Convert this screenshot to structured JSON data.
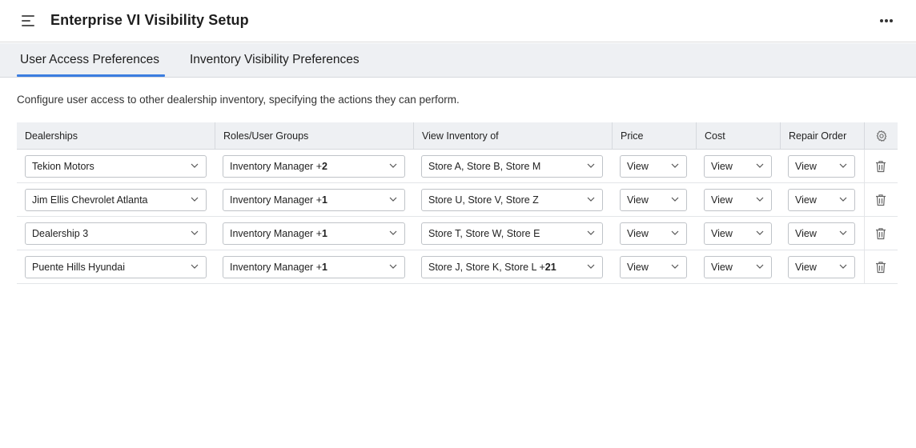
{
  "header": {
    "title": "Enterprise VI Visibility Setup",
    "menu_icon": "hamburger-menu-icon",
    "more_icon": "more-horizontal-icon"
  },
  "tabs": [
    {
      "label": "User Access Preferences",
      "active": true
    },
    {
      "label": "Inventory Visibility Preferences",
      "active": false
    }
  ],
  "colors": {
    "accent": "#3b7de0",
    "header_bg": "#eef0f3"
  },
  "description": "Configure user access to other dealership inventory, specifying the actions they can perform.",
  "table": {
    "columns": [
      "Dealerships",
      "Roles/User Groups",
      "View Inventory of",
      "Price",
      "Cost",
      "Repair Order"
    ],
    "settings_icon": "gear-icon",
    "delete_icon": "trash-icon",
    "rows": [
      {
        "dealership": "Tekion Motors",
        "roles": "Inventory Manager +",
        "roles_count": "2",
        "stores": "Store A, Store B, Store M",
        "stores_count": "",
        "price": "View",
        "cost": "View",
        "repair_order": "View"
      },
      {
        "dealership": "Jim Ellis Chevrolet Atlanta",
        "roles": "Inventory Manager +",
        "roles_count": "1",
        "stores": "Store U, Store V, Store Z",
        "stores_count": "",
        "price": "View",
        "cost": "View",
        "repair_order": "View"
      },
      {
        "dealership": "Dealership 3",
        "roles": "Inventory Manager +",
        "roles_count": "1",
        "stores": "Store T, Store W, Store E",
        "stores_count": "",
        "price": "View",
        "cost": "View",
        "repair_order": "View"
      },
      {
        "dealership": "Puente Hills Hyundai",
        "roles": "Inventory Manager +",
        "roles_count": "1",
        "stores": "Store J, Store K, Store L +",
        "stores_count": "21",
        "price": "View",
        "cost": "View",
        "repair_order": "View"
      }
    ]
  }
}
